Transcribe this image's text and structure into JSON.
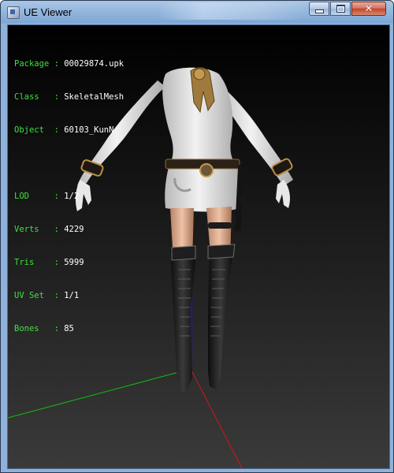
{
  "window": {
    "title": "UE Viewer",
    "controls": {
      "minimize": "",
      "maximize": "",
      "close": "✕"
    }
  },
  "info_panel": {
    "package": {
      "label": "Package",
      "value": "00029874.upk"
    },
    "class": {
      "label": "Class",
      "value": "SkeletalMesh"
    },
    "object": {
      "label": "Object",
      "value": "60103_KunN"
    },
    "lod": {
      "label": "LOD",
      "value": "1/2"
    },
    "verts": {
      "label": "Verts",
      "value": "4229"
    },
    "tris": {
      "label": "Tris",
      "value": "5999"
    },
    "uvset": {
      "label": "UV Set",
      "value": "1/1"
    },
    "bones": {
      "label": "Bones",
      "value": "85"
    }
  },
  "colors": {
    "label_green": "#3fe03f",
    "value_white": "#ffffff",
    "axis_x": "#d01818",
    "axis_y": "#10c010",
    "axis_z": "#1818e0"
  }
}
